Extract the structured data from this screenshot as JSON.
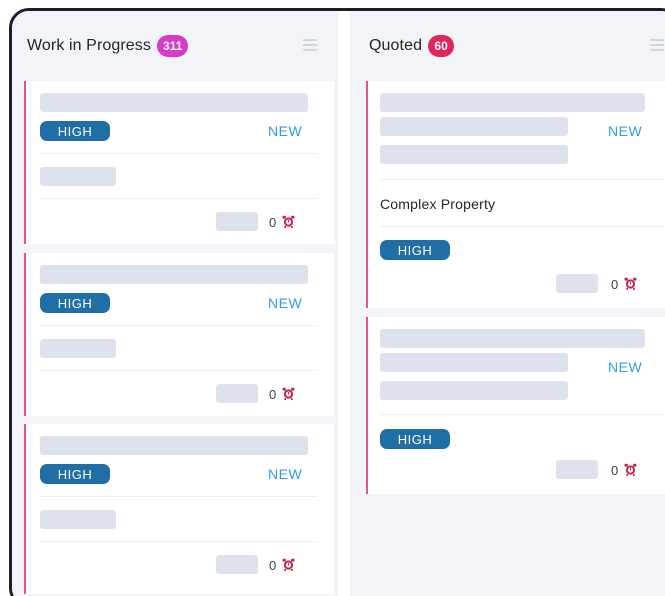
{
  "columns": [
    {
      "title": "Work in Progress",
      "count": "311",
      "badge_color": "#d83bc9",
      "cards": [
        {
          "priority": "HIGH",
          "status": "NEW",
          "comment_count": "0"
        },
        {
          "priority": "HIGH",
          "status": "NEW",
          "comment_count": "0"
        },
        {
          "priority": "HIGH",
          "status": "NEW",
          "comment_count": "0"
        }
      ]
    },
    {
      "title": "Quoted",
      "count": "60",
      "badge_color": "#e0265a",
      "cards": [
        {
          "priority": "HIGH",
          "status": "NEW",
          "description": "Complex Property",
          "comment_count": "0"
        },
        {
          "priority": "HIGH",
          "status": "NEW",
          "comment_count": "0"
        }
      ]
    }
  ],
  "colors": {
    "card_accent": "#e2538f",
    "priority_badge": "#1f6ea5",
    "new_label": "#2f9ee6",
    "alarm_icon": "#c8234a"
  },
  "icons": {
    "column_menu": "menu-lines-icon",
    "comment_alarm": "alarm-clock-icon"
  }
}
